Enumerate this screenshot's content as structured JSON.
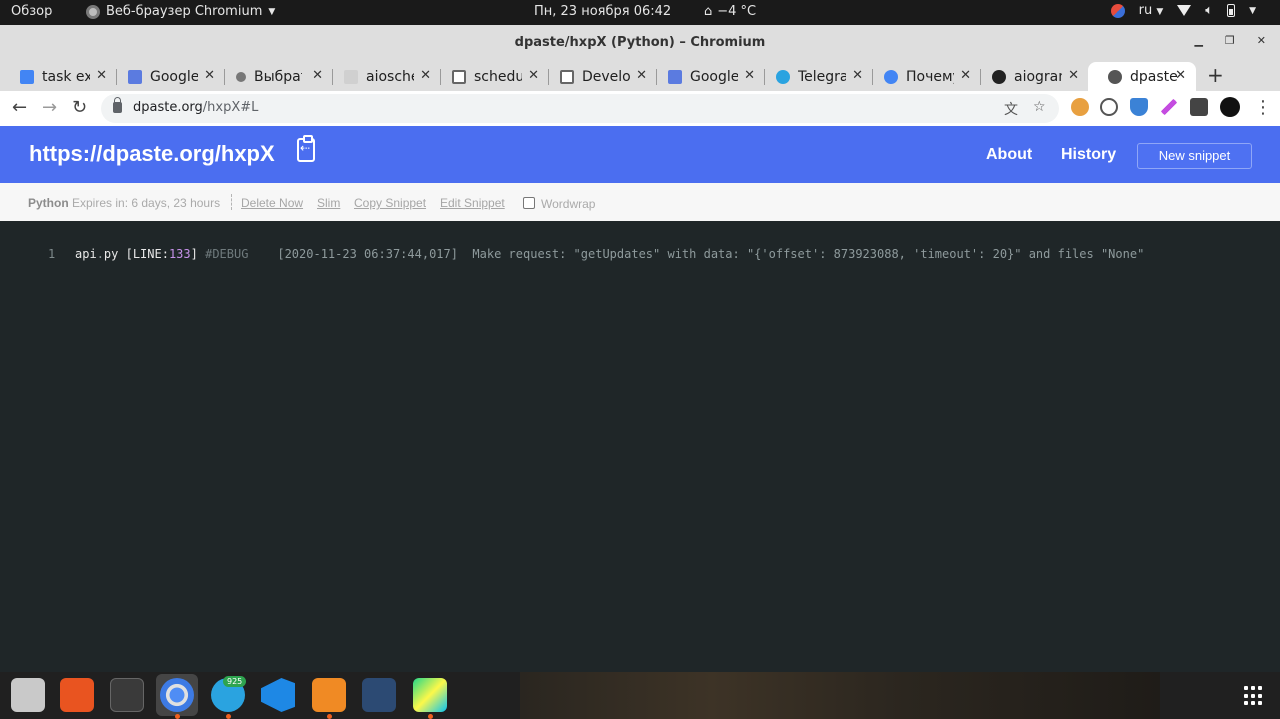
{
  "gnome": {
    "activities": "Обзор",
    "app_menu": "Веб-браузер Chromium",
    "clock": "Пн, 23 ноября  06:42",
    "weather": "−4 °C",
    "keyboard_layout": "ru"
  },
  "window": {
    "title": "dpaste/hxpX (Python) – Chromium"
  },
  "tabs": [
    {
      "title": "task exe",
      "favicon": "google-icon",
      "color": "#4285f4"
    },
    {
      "title": "Google",
      "favicon": "google-translate-icon",
      "color": "#5b7be0"
    },
    {
      "title": "Выбрат",
      "favicon": "generic-icon",
      "color": "#777777"
    },
    {
      "title": "aiosche",
      "favicon": "blank-icon",
      "color": "#d0d0d0"
    },
    {
      "title": "schedul",
      "favicon": "doc-icon",
      "color": "#666666"
    },
    {
      "title": "Develop",
      "favicon": "doc-icon",
      "color": "#666666"
    },
    {
      "title": "Google",
      "favicon": "google-translate-icon",
      "color": "#5b7be0"
    },
    {
      "title": "Telegra",
      "favicon": "telegram-icon",
      "color": "#2aa3e0"
    },
    {
      "title": "Почему",
      "favicon": "google-icon",
      "color": "#4285f4"
    },
    {
      "title": "aiogran",
      "favicon": "github-icon",
      "color": "#222222"
    },
    {
      "title": "dpaste",
      "favicon": "globe-icon",
      "color": "#555555"
    }
  ],
  "omnibox": {
    "host": "dpaste.org",
    "path": "/hxpX#L"
  },
  "page": {
    "site_title": "https://dpaste.org/hxpX",
    "nav_about": "About",
    "nav_history": "History",
    "new_snippet": "New snippet",
    "lexer": "Python",
    "expires": " Expires in: 6 days, 23 hours",
    "actions": {
      "delete_now": "Delete Now",
      "slim": "Slim",
      "copy_snippet": "Copy Snippet",
      "edit_snippet": "Edit Snippet",
      "wordwrap": "Wordwrap"
    },
    "code": {
      "line_number": "1",
      "file": "api",
      "dot": ".",
      "ext": "py",
      "bracket_open": " [LINE:",
      "line_no": "133",
      "bracket_close": "]",
      "tag": " #DEBUG",
      "message": "    [2020-11-23 06:37:44,017]  Make request: \"getUpdates\" with data: \"{'offset': 873923088, 'timeout': 20}\" and files \"None\""
    }
  },
  "dock": {
    "telegram_badge": "925",
    "apps": [
      "files-icon",
      "app-center-icon",
      "terminal-icon",
      "chromium-icon",
      "telegram-icon",
      "vscode-icon",
      "sublime-text-icon",
      "mysql-workbench-icon",
      "pycharm-icon"
    ]
  }
}
